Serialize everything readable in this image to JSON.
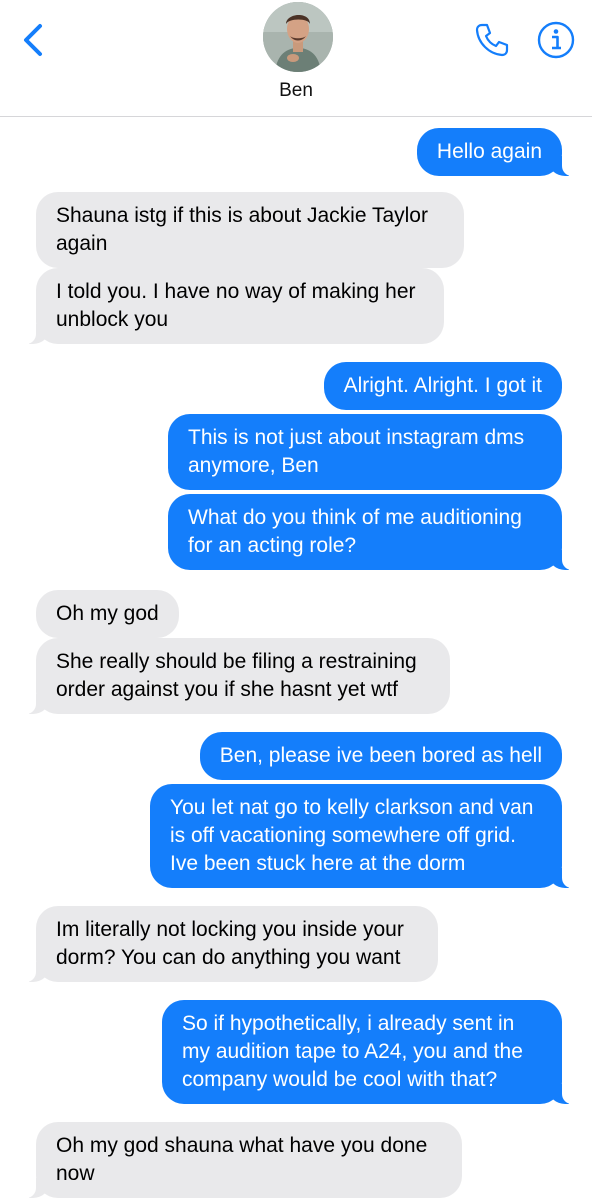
{
  "contact": {
    "name": "Ben",
    "avatar_icon": "contact-photo"
  },
  "header": {
    "back_icon": "chevron-left-icon",
    "call_icon": "phone-icon",
    "info_icon": "info-icon"
  },
  "colors": {
    "accent": "#147EFB",
    "received_bubble": "#E9E9EB",
    "sent_text": "#FFFFFF"
  },
  "messages": [
    {
      "from": "me",
      "text": "Hello again"
    },
    {
      "from": "ben",
      "text": "Shauna istg if this is about Jackie Taylor\nagain"
    },
    {
      "from": "ben",
      "text": "I told you. I have no way of making her\nunblock you"
    },
    {
      "from": "me",
      "text": "Alright. Alright. I got it"
    },
    {
      "from": "me",
      "text": "This is not just about instagram dms\nanymore, Ben"
    },
    {
      "from": "me",
      "text": "What do you think of me auditioning\nfor an acting role?"
    },
    {
      "from": "ben",
      "text": "Oh my god"
    },
    {
      "from": "ben",
      "text": "She really should be filing a restraining\norder against you if she hasnt yet wtf"
    },
    {
      "from": "me",
      "text": "Ben, please ive been bored as hell"
    },
    {
      "from": "me",
      "text": "You let nat go to kelly clarkson and van\nis off vacationing somewhere off grid.\nIve been stuck here at the dorm"
    },
    {
      "from": "ben",
      "text": "Im literally not locking you inside your\ndorm? You can do anything you want"
    },
    {
      "from": "me",
      "text": "So if hypothetically, i already sent in\nmy audition tape to A24, you and the\ncompany would be cool with that?"
    },
    {
      "from": "ben",
      "text": "Oh my god shauna what have you done\nnow"
    }
  ]
}
